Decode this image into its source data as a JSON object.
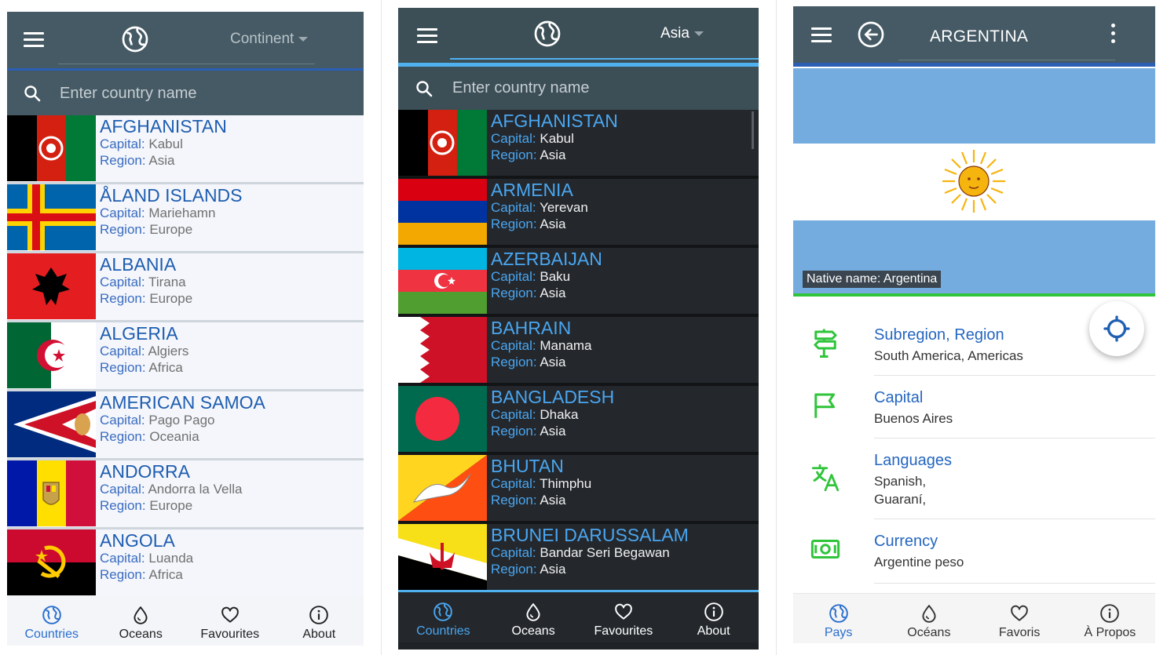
{
  "colors": {
    "header": "#455a64",
    "accent": "#2a5fb4",
    "dark_accent": "#4fb1ef",
    "light_bg": "#eaeef5",
    "dark_bg": "#1f2327",
    "active_tab": "#2a6fcf",
    "green_icon": "#2fc43a"
  },
  "screen1": {
    "dropdown": "Continent",
    "search_placeholder": "Enter country name",
    "countries": [
      {
        "name": "AFGHANISTAN",
        "capital_label": "Capital:",
        "capital": "Kabul",
        "region_label": "Region:",
        "region": "Asia"
      },
      {
        "name": "ÅLAND ISLANDS",
        "capital_label": "Capital:",
        "capital": "Mariehamn",
        "region_label": "Region:",
        "region": "Europe"
      },
      {
        "name": "ALBANIA",
        "capital_label": "Capital:",
        "capital": "Tirana",
        "region_label": "Region:",
        "region": "Europe"
      },
      {
        "name": "ALGERIA",
        "capital_label": "Capital:",
        "capital": "Algiers",
        "region_label": "Region:",
        "region": "Africa"
      },
      {
        "name": "AMERICAN SAMOA",
        "capital_label": "Capital:",
        "capital": "Pago Pago",
        "region_label": "Region:",
        "region": "Oceania"
      },
      {
        "name": "ANDORRA",
        "capital_label": "Capital:",
        "capital": "Andorra la Vella",
        "region_label": "Region:",
        "region": "Europe"
      },
      {
        "name": "ANGOLA",
        "capital_label": "Capital:",
        "capital": "Luanda",
        "region_label": "Region:",
        "region": "Africa"
      }
    ],
    "nav": [
      {
        "label": "Countries",
        "icon": "globe-icon",
        "active": true
      },
      {
        "label": "Oceans",
        "icon": "drop-icon"
      },
      {
        "label": "Favourites",
        "icon": "heart-icon"
      },
      {
        "label": "About",
        "icon": "info-icon"
      }
    ]
  },
  "screen2": {
    "dropdown": "Asia",
    "search_placeholder": "Enter country name",
    "countries": [
      {
        "name": "AFGHANISTAN",
        "capital_label": "Capital:",
        "capital": "Kabul",
        "region_label": "Region:",
        "region": "Asia"
      },
      {
        "name": "ARMENIA",
        "capital_label": "Capital:",
        "capital": "Yerevan",
        "region_label": "Region:",
        "region": "Asia"
      },
      {
        "name": "AZERBAIJAN",
        "capital_label": "Capital:",
        "capital": "Baku",
        "region_label": "Region:",
        "region": "Asia"
      },
      {
        "name": "BAHRAIN",
        "capital_label": "Capital:",
        "capital": "Manama",
        "region_label": "Region:",
        "region": "Asia"
      },
      {
        "name": "BANGLADESH",
        "capital_label": "Capital:",
        "capital": "Dhaka",
        "region_label": "Region:",
        "region": "Asia"
      },
      {
        "name": "BHUTAN",
        "capital_label": "Capital:",
        "capital": "Thimphu",
        "region_label": "Region:",
        "region": "Asia"
      },
      {
        "name": "BRUNEI DARUSSALAM",
        "capital_label": "Capital:",
        "capital": "Bandar Seri Begawan",
        "region_label": "Region:",
        "region": "Asia"
      }
    ],
    "nav": [
      {
        "label": "Countries",
        "icon": "globe-icon",
        "active": true
      },
      {
        "label": "Oceans",
        "icon": "drop-icon"
      },
      {
        "label": "Favourites",
        "icon": "heart-icon"
      },
      {
        "label": "About",
        "icon": "info-icon"
      }
    ]
  },
  "screen3": {
    "title": "ARGENTINA",
    "native_name": "Native name: Argentina",
    "details": [
      {
        "label": "Subregion, Region",
        "value": "South America, Americas",
        "icon": "signpost-icon"
      },
      {
        "label": "Capital",
        "value": "Buenos Aires",
        "icon": "flag-outline-icon"
      },
      {
        "label": "Languages",
        "value": "Spanish,",
        "value2": "Guaraní,",
        "icon": "translate-icon"
      },
      {
        "label": "Currency",
        "value": "Argentine peso",
        "icon": "banknote-icon"
      }
    ],
    "fab_icon": "crosshair-icon",
    "nav": [
      {
        "label": "Pays",
        "icon": "globe-icon",
        "active": true
      },
      {
        "label": "Océans",
        "icon": "drop-icon"
      },
      {
        "label": "Favoris",
        "icon": "heart-icon"
      },
      {
        "label": "À Propos",
        "icon": "info-icon"
      }
    ]
  }
}
